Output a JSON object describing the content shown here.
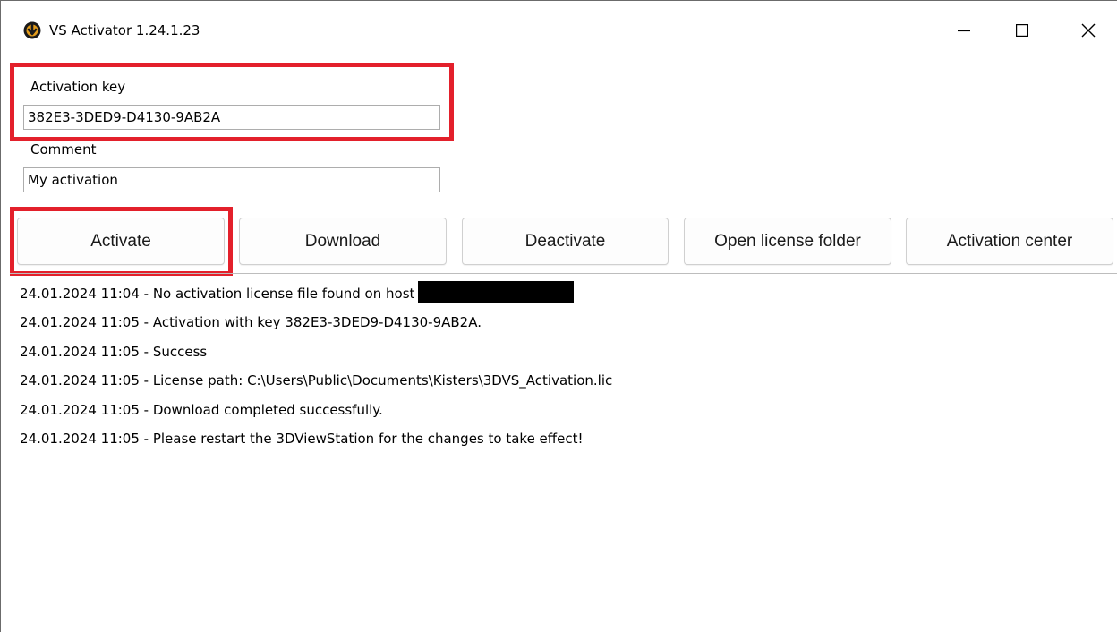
{
  "window": {
    "title": "VS Activator 1.24.1.23",
    "controls": [
      "minimize-icon",
      "maximize-icon",
      "close-icon"
    ]
  },
  "form": {
    "activation_key_label": "Activation key",
    "activation_key_value": "382E3-3DED9-D4130-9AB2A",
    "comment_label": "Comment",
    "comment_value": "My activation"
  },
  "buttons": {
    "activate": "Activate",
    "download": "Download",
    "deactivate": "Deactivate",
    "open_license_folder": "Open license folder",
    "activation_center": "Activation center"
  },
  "log": [
    "24.01.2024 11:04 - No activation license file found on host",
    "24.01.2024 11:05 - Activation with key 382E3-3DED9-D4130-9AB2A.",
    "24.01.2024 11:05 - Success",
    "24.01.2024 11:05 - License path: C:\\Users\\Public\\Documents\\Kisters\\3DVS_Activation.lic",
    "24.01.2024 11:05 - Download completed successfully.",
    "24.01.2024 11:05 - Please restart the 3DViewStation for the changes to take effect!"
  ],
  "colors": {
    "highlight": "#e3202b",
    "app_icon": "#e39c1b"
  }
}
